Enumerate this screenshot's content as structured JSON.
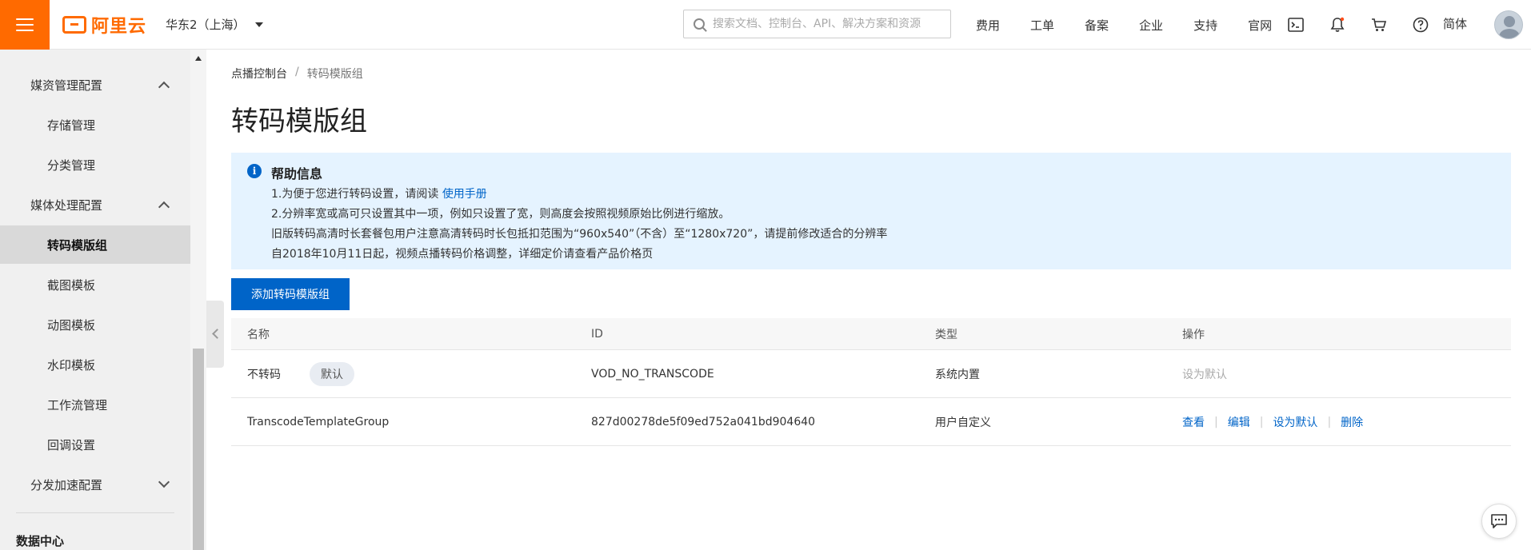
{
  "topbar": {
    "logo_text": "阿里云",
    "region": "华东2（上海）",
    "search_placeholder": "搜索文档、控制台、API、解决方案和资源",
    "links": [
      "费用",
      "工单",
      "备案",
      "企业",
      "支持",
      "官网"
    ],
    "icons": [
      "terminal-icon",
      "bell-icon",
      "cart-icon",
      "help-icon"
    ],
    "language": "简体",
    "accent_color": "#ff6a00"
  },
  "sidebar": {
    "groups": [
      {
        "label": "媒资管理配置",
        "expanded": true,
        "items": [
          "存储管理",
          "分类管理"
        ]
      },
      {
        "label": "媒体处理配置",
        "expanded": true,
        "items": [
          "转码模版组",
          "截图模板",
          "动图模板",
          "水印模板",
          "工作流管理",
          "回调设置"
        ]
      },
      {
        "label": "分发加速配置",
        "expanded": false,
        "items": []
      }
    ],
    "active_item": "转码模版组",
    "section": "数据中心"
  },
  "breadcrumb": {
    "root": "点播控制台",
    "current": "转码模版组"
  },
  "page": {
    "title": "转码模版组"
  },
  "help": {
    "title": "帮助信息",
    "line1_prefix": "1.为便于您进行转码设置，请阅读 ",
    "line1_link": "使用手册",
    "line2": "2.分辨率宽或高可只设置其中一项，例如只设置了宽，则高度会按照视频原始比例进行缩放。",
    "line3": "旧版转码高清时长套餐包用户注意高清转码时长包抵扣范围为“960x540”（不含）至“1280x720”，请提前修改适合的分辨率",
    "line4": "自2018年10月11日起，视频点播转码价格调整，详细定价请查看产品价格页"
  },
  "actions": {
    "add_label": "添加转码模版组"
  },
  "table": {
    "headers": [
      "名称",
      "ID",
      "类型",
      "操作"
    ],
    "rows": [
      {
        "name": "不转码",
        "badge": "默认",
        "id": "VOD_NO_TRANSCODE",
        "type": "系统内置",
        "ops_disabled": "设为默认"
      },
      {
        "name": "TranscodeTemplateGroup",
        "id": "827d00278de5f09ed752a041bd904640",
        "type": "用户自定义",
        "ops": [
          "查看",
          "编辑",
          "设为默认",
          "删除"
        ]
      }
    ]
  },
  "link_color": "#0064c8"
}
